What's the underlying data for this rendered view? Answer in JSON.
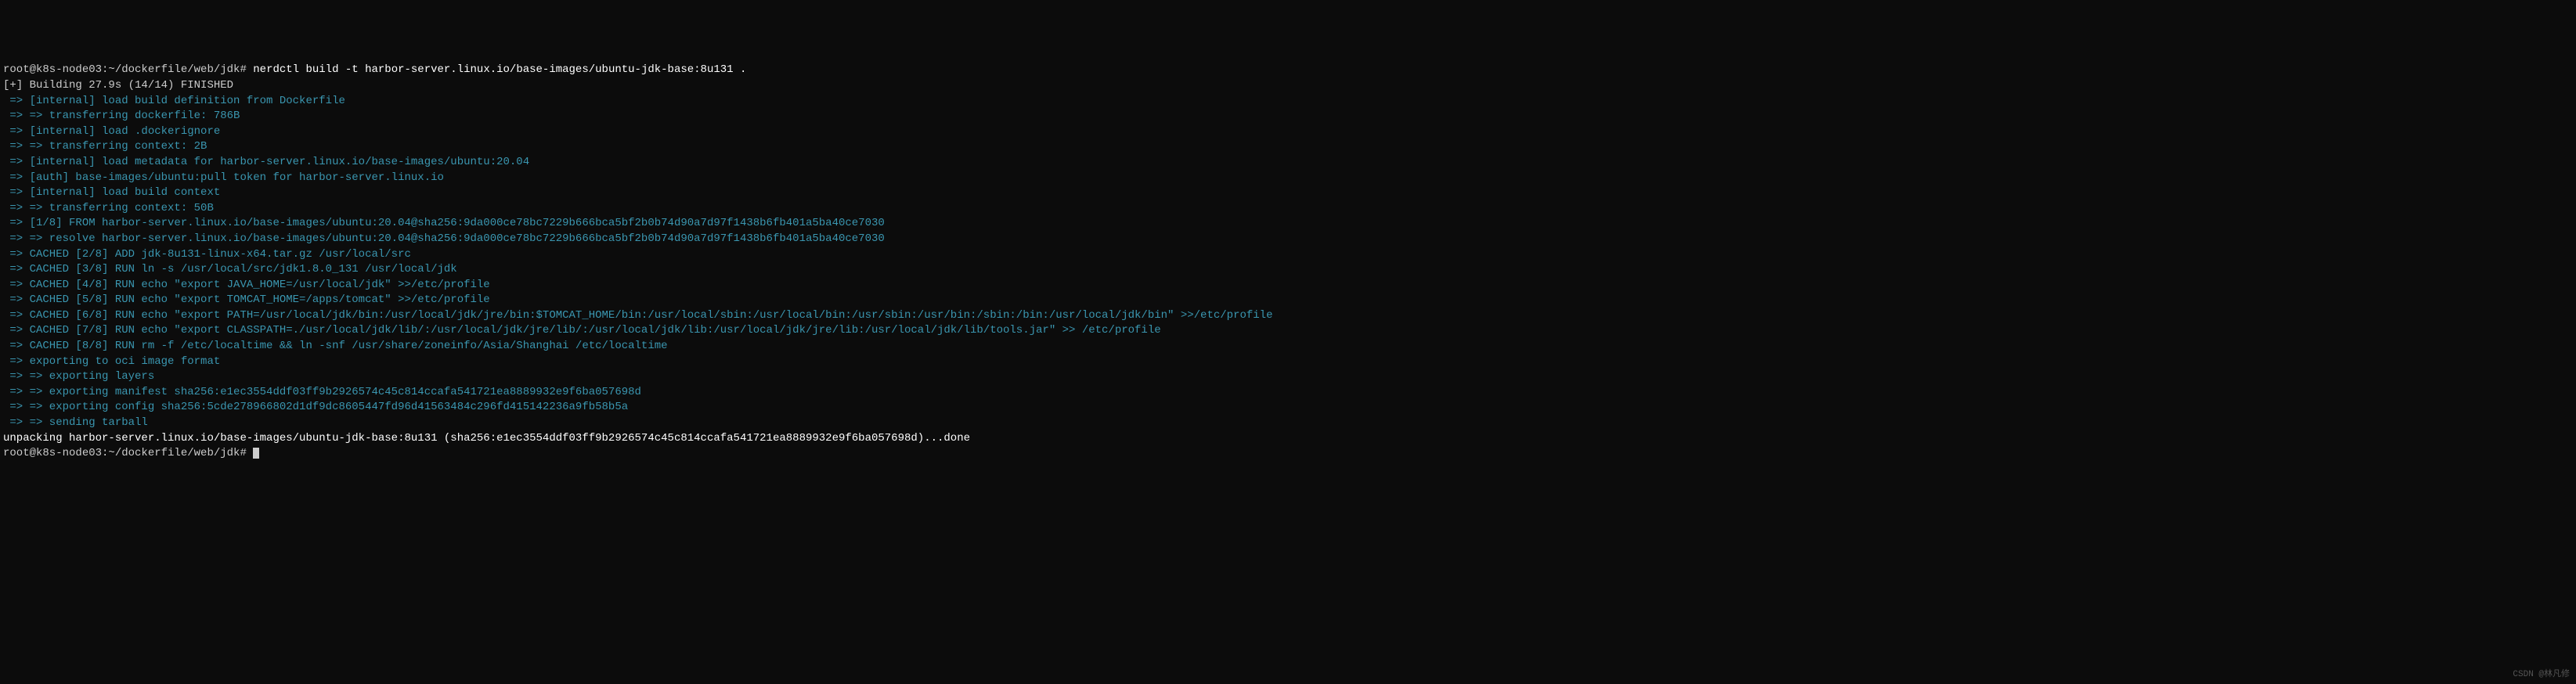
{
  "terminal": {
    "prompt1": "root@k8s-node03:~/dockerfile/web/jdk# ",
    "command1": "nerdctl build -t harbor-server.linux.io/base-images/ubuntu-jdk-base:8u131 .",
    "build_status": "[+] Building 27.9s (14/14) FINISHED",
    "lines": [
      " => [internal] load build definition from Dockerfile",
      " => => transferring dockerfile: 786B",
      " => [internal] load .dockerignore",
      " => => transferring context: 2B",
      " => [internal] load metadata for harbor-server.linux.io/base-images/ubuntu:20.04",
      " => [auth] base-images/ubuntu:pull token for harbor-server.linux.io",
      " => [internal] load build context",
      " => => transferring context: 50B",
      " => [1/8] FROM harbor-server.linux.io/base-images/ubuntu:20.04@sha256:9da000ce78bc7229b666bca5bf2b0b74d90a7d97f1438b6fb401a5ba40ce7030",
      " => => resolve harbor-server.linux.io/base-images/ubuntu:20.04@sha256:9da000ce78bc7229b666bca5bf2b0b74d90a7d97f1438b6fb401a5ba40ce7030",
      " => CACHED [2/8] ADD jdk-8u131-linux-x64.tar.gz /usr/local/src",
      " => CACHED [3/8] RUN ln -s /usr/local/src/jdk1.8.0_131 /usr/local/jdk",
      " => CACHED [4/8] RUN echo \"export JAVA_HOME=/usr/local/jdk\" >>/etc/profile",
      " => CACHED [5/8] RUN echo \"export TOMCAT_HOME=/apps/tomcat\" >>/etc/profile",
      " => CACHED [6/8] RUN echo \"export PATH=/usr/local/jdk/bin:/usr/local/jdk/jre/bin:$TOMCAT_HOME/bin:/usr/local/sbin:/usr/local/bin:/usr/sbin:/usr/bin:/sbin:/bin:/usr/local/jdk/bin\" >>/etc/profile",
      " => CACHED [7/8] RUN echo \"export CLASSPATH=./usr/local/jdk/lib/:/usr/local/jdk/jre/lib/:/usr/local/jdk/lib:/usr/local/jdk/jre/lib:/usr/local/jdk/lib/tools.jar\" >> /etc/profile",
      " => CACHED [8/8] RUN rm -f /etc/localtime && ln -snf /usr/share/zoneinfo/Asia/Shanghai /etc/localtime",
      " => exporting to oci image format",
      " => => exporting layers",
      " => => exporting manifest sha256:e1ec3554ddf03ff9b2926574c45c814ccafa541721ea8889932e9f6ba057698d",
      " => => exporting config sha256:5cde278966802d1df9dc8605447fd96d41563484c296fd415142236a9fb58b5a",
      " => => sending tarball"
    ],
    "unpacking": "unpacking harbor-server.linux.io/base-images/ubuntu-jdk-base:8u131 (sha256:e1ec3554ddf03ff9b2926574c45c814ccafa541721ea8889932e9f6ba057698d)...done",
    "prompt2": "root@k8s-node03:~/dockerfile/web/jdk# ",
    "watermark": "CSDN @林凡修"
  }
}
